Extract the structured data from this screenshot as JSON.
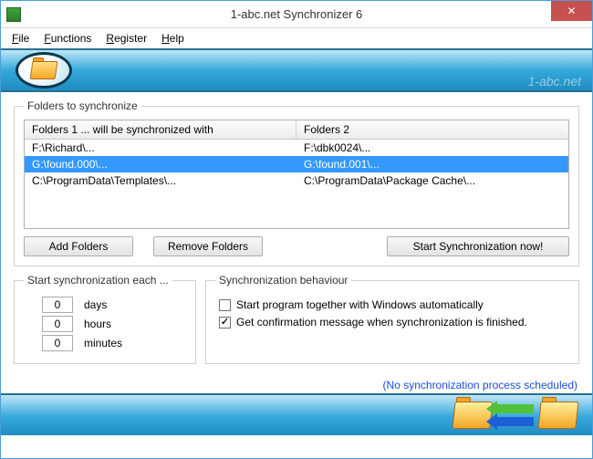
{
  "window": {
    "title": "1-abc.net Synchronizer 6",
    "brand_watermark": "1-abc.net"
  },
  "menu": {
    "file": "File",
    "functions": "Functions",
    "register": "Register",
    "help": "Help"
  },
  "folders_fieldset": {
    "legend": "Folders to synchronize",
    "header_col1": "Folders 1 ... will be synchronized with",
    "header_col2": "Folders 2",
    "rows": [
      {
        "col1": "F:\\Richard\\...",
        "col2": "F:\\dbk0024\\...",
        "selected": false
      },
      {
        "col1": "G:\\found.000\\...",
        "col2": "G:\\found.001\\...",
        "selected": true
      },
      {
        "col1": "C:\\ProgramData\\Templates\\...",
        "col2": "C:\\ProgramData\\Package Cache\\...",
        "selected": false
      }
    ]
  },
  "buttons": {
    "add": "Add Folders",
    "remove": "Remove Folders",
    "start": "Start Synchronization now!"
  },
  "schedule": {
    "legend": "Start synchronization each ...",
    "days_value": "0",
    "days_label": "days",
    "hours_value": "0",
    "hours_label": "hours",
    "minutes_value": "0",
    "minutes_label": "minutes"
  },
  "behaviour": {
    "legend": "Synchronization behaviour",
    "autostart_label": "Start program together with Windows automatically",
    "autostart_checked": false,
    "confirm_label": "Get confirmation message when synchronization is finished.",
    "confirm_checked": true
  },
  "status": {
    "text": "(No synchronization process scheduled)"
  }
}
